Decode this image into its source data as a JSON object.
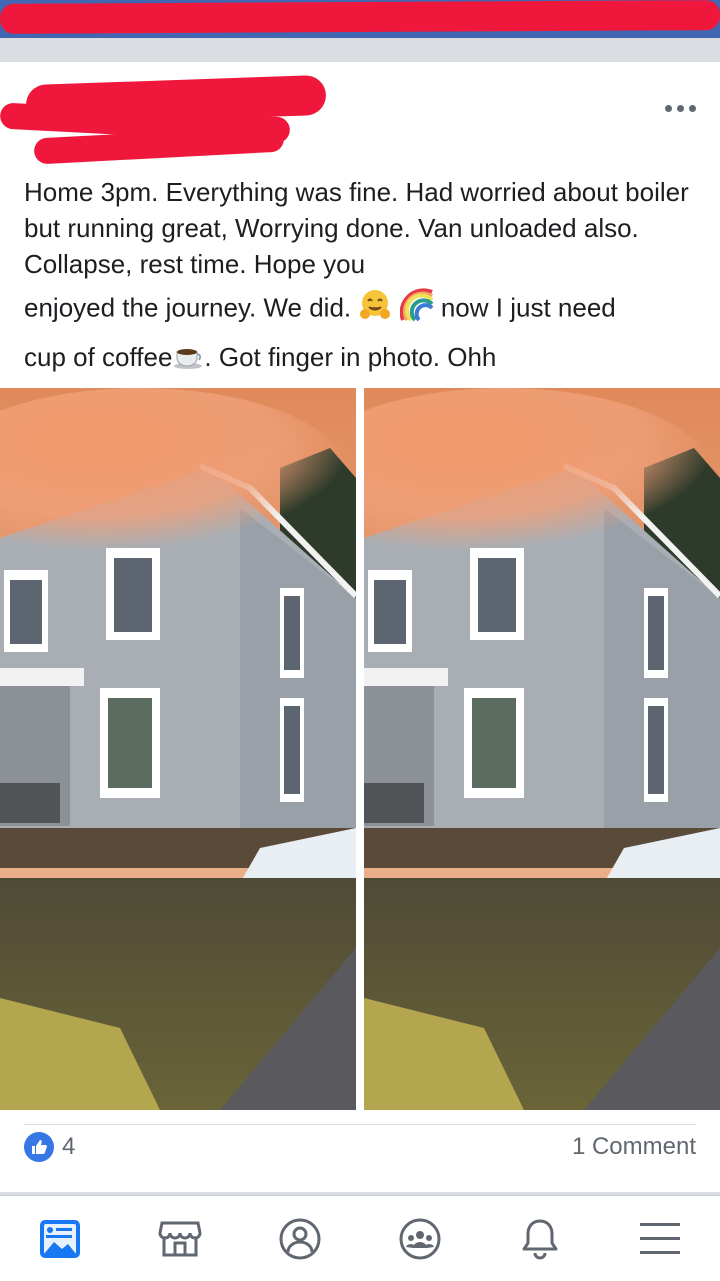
{
  "post": {
    "lines": [
      "Home 3pm.   Everything was fine.  Had worried about boiler but running great,  Worrying done.  Van unloaded also.  Collapse,  rest time.  Hope you",
      "enjoyed the journey.  We did.",
      "now I just need",
      "cup of coffee",
      ".  Got finger in photo.  Ohh"
    ],
    "emojis": [
      "hugging-face",
      "rainbow",
      "hot-beverage"
    ]
  },
  "reactions": {
    "like_count": "4",
    "comment_count": "1 Comment"
  },
  "tabbar": {
    "items": [
      "news-feed-icon",
      "marketplace-icon",
      "profile-icon",
      "groups-icon",
      "notifications-icon",
      "menu-icon"
    ],
    "active_color": "#1877f2",
    "inactive_color": "#606770"
  },
  "colors": {
    "header": "#4267b2",
    "redaction": "#f0173c",
    "like": "#3578e5"
  }
}
